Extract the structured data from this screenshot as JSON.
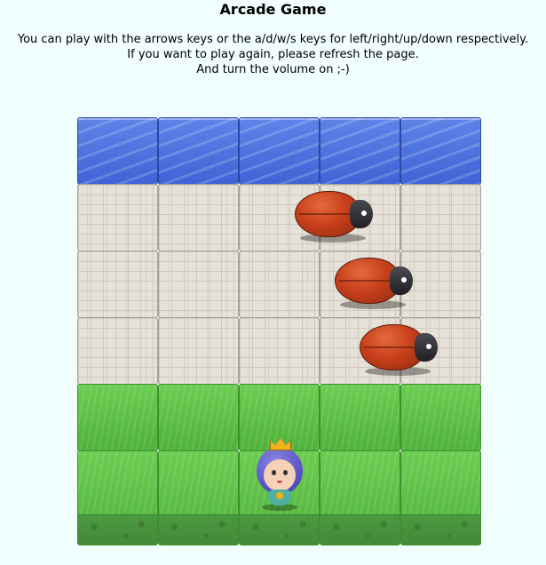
{
  "header": {
    "title": "Arcade Game",
    "instructions": [
      "You can play with the arrows keys or the a/d/w/s keys for left/right/up/down respectively.",
      "If you want to play again, please refresh the page.",
      "And turn the volume on ;-)"
    ]
  },
  "board": {
    "rows": [
      "water",
      "stone",
      "stone",
      "stone",
      "grass",
      "grass"
    ],
    "columns": 5,
    "enemies": [
      {
        "name": "enemy-bug-1",
        "row": 1,
        "col": 2.7
      },
      {
        "name": "enemy-bug-2",
        "row": 2,
        "col": 3.2
      },
      {
        "name": "enemy-bug-3",
        "row": 3,
        "col": 3.5
      }
    ],
    "player": {
      "row": 5,
      "col": 2,
      "character": "princess"
    }
  }
}
